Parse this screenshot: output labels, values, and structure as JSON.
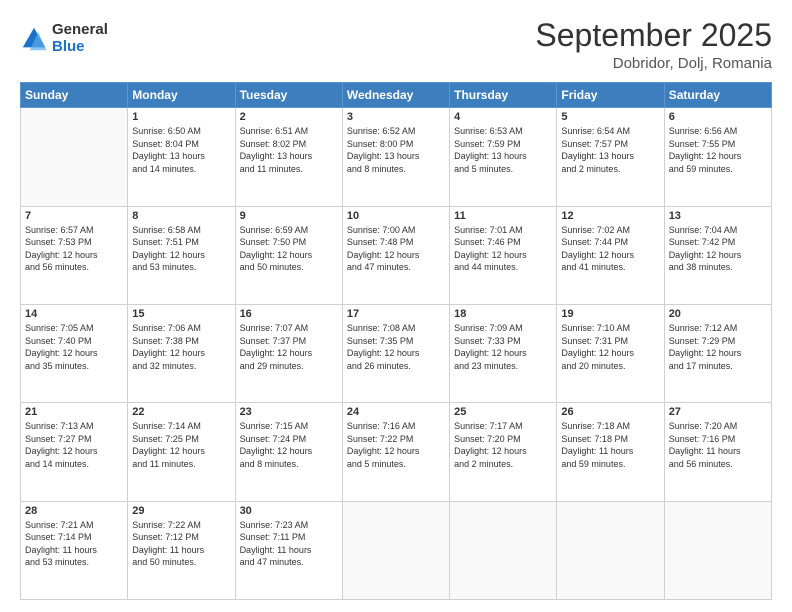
{
  "logo": {
    "general": "General",
    "blue": "Blue"
  },
  "header": {
    "title": "September 2025",
    "subtitle": "Dobridor, Dolj, Romania"
  },
  "weekdays": [
    "Sunday",
    "Monday",
    "Tuesday",
    "Wednesday",
    "Thursday",
    "Friday",
    "Saturday"
  ],
  "weeks": [
    [
      {
        "num": "",
        "info": ""
      },
      {
        "num": "1",
        "info": "Sunrise: 6:50 AM\nSunset: 8:04 PM\nDaylight: 13 hours\nand 14 minutes."
      },
      {
        "num": "2",
        "info": "Sunrise: 6:51 AM\nSunset: 8:02 PM\nDaylight: 13 hours\nand 11 minutes."
      },
      {
        "num": "3",
        "info": "Sunrise: 6:52 AM\nSunset: 8:00 PM\nDaylight: 13 hours\nand 8 minutes."
      },
      {
        "num": "4",
        "info": "Sunrise: 6:53 AM\nSunset: 7:59 PM\nDaylight: 13 hours\nand 5 minutes."
      },
      {
        "num": "5",
        "info": "Sunrise: 6:54 AM\nSunset: 7:57 PM\nDaylight: 13 hours\nand 2 minutes."
      },
      {
        "num": "6",
        "info": "Sunrise: 6:56 AM\nSunset: 7:55 PM\nDaylight: 12 hours\nand 59 minutes."
      }
    ],
    [
      {
        "num": "7",
        "info": "Sunrise: 6:57 AM\nSunset: 7:53 PM\nDaylight: 12 hours\nand 56 minutes."
      },
      {
        "num": "8",
        "info": "Sunrise: 6:58 AM\nSunset: 7:51 PM\nDaylight: 12 hours\nand 53 minutes."
      },
      {
        "num": "9",
        "info": "Sunrise: 6:59 AM\nSunset: 7:50 PM\nDaylight: 12 hours\nand 50 minutes."
      },
      {
        "num": "10",
        "info": "Sunrise: 7:00 AM\nSunset: 7:48 PM\nDaylight: 12 hours\nand 47 minutes."
      },
      {
        "num": "11",
        "info": "Sunrise: 7:01 AM\nSunset: 7:46 PM\nDaylight: 12 hours\nand 44 minutes."
      },
      {
        "num": "12",
        "info": "Sunrise: 7:02 AM\nSunset: 7:44 PM\nDaylight: 12 hours\nand 41 minutes."
      },
      {
        "num": "13",
        "info": "Sunrise: 7:04 AM\nSunset: 7:42 PM\nDaylight: 12 hours\nand 38 minutes."
      }
    ],
    [
      {
        "num": "14",
        "info": "Sunrise: 7:05 AM\nSunset: 7:40 PM\nDaylight: 12 hours\nand 35 minutes."
      },
      {
        "num": "15",
        "info": "Sunrise: 7:06 AM\nSunset: 7:38 PM\nDaylight: 12 hours\nand 32 minutes."
      },
      {
        "num": "16",
        "info": "Sunrise: 7:07 AM\nSunset: 7:37 PM\nDaylight: 12 hours\nand 29 minutes."
      },
      {
        "num": "17",
        "info": "Sunrise: 7:08 AM\nSunset: 7:35 PM\nDaylight: 12 hours\nand 26 minutes."
      },
      {
        "num": "18",
        "info": "Sunrise: 7:09 AM\nSunset: 7:33 PM\nDaylight: 12 hours\nand 23 minutes."
      },
      {
        "num": "19",
        "info": "Sunrise: 7:10 AM\nSunset: 7:31 PM\nDaylight: 12 hours\nand 20 minutes."
      },
      {
        "num": "20",
        "info": "Sunrise: 7:12 AM\nSunset: 7:29 PM\nDaylight: 12 hours\nand 17 minutes."
      }
    ],
    [
      {
        "num": "21",
        "info": "Sunrise: 7:13 AM\nSunset: 7:27 PM\nDaylight: 12 hours\nand 14 minutes."
      },
      {
        "num": "22",
        "info": "Sunrise: 7:14 AM\nSunset: 7:25 PM\nDaylight: 12 hours\nand 11 minutes."
      },
      {
        "num": "23",
        "info": "Sunrise: 7:15 AM\nSunset: 7:24 PM\nDaylight: 12 hours\nand 8 minutes."
      },
      {
        "num": "24",
        "info": "Sunrise: 7:16 AM\nSunset: 7:22 PM\nDaylight: 12 hours\nand 5 minutes."
      },
      {
        "num": "25",
        "info": "Sunrise: 7:17 AM\nSunset: 7:20 PM\nDaylight: 12 hours\nand 2 minutes."
      },
      {
        "num": "26",
        "info": "Sunrise: 7:18 AM\nSunset: 7:18 PM\nDaylight: 11 hours\nand 59 minutes."
      },
      {
        "num": "27",
        "info": "Sunrise: 7:20 AM\nSunset: 7:16 PM\nDaylight: 11 hours\nand 56 minutes."
      }
    ],
    [
      {
        "num": "28",
        "info": "Sunrise: 7:21 AM\nSunset: 7:14 PM\nDaylight: 11 hours\nand 53 minutes."
      },
      {
        "num": "29",
        "info": "Sunrise: 7:22 AM\nSunset: 7:12 PM\nDaylight: 11 hours\nand 50 minutes."
      },
      {
        "num": "30",
        "info": "Sunrise: 7:23 AM\nSunset: 7:11 PM\nDaylight: 11 hours\nand 47 minutes."
      },
      {
        "num": "",
        "info": ""
      },
      {
        "num": "",
        "info": ""
      },
      {
        "num": "",
        "info": ""
      },
      {
        "num": "",
        "info": ""
      }
    ]
  ]
}
